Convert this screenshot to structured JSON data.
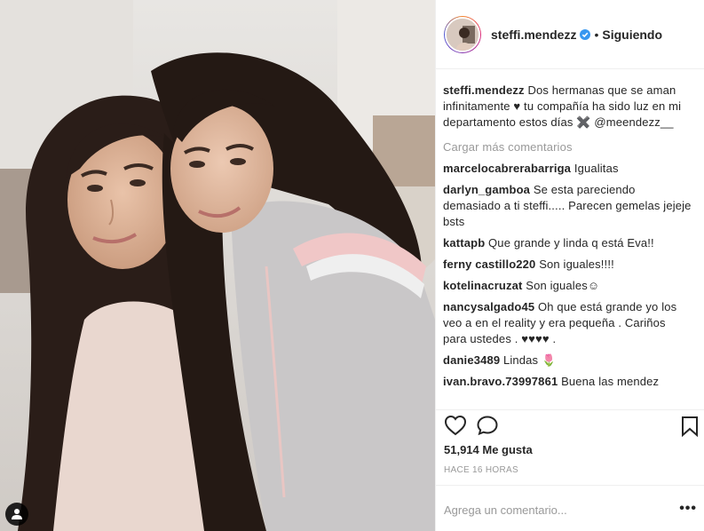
{
  "post": {
    "username": "steffi.mendezz",
    "follow_status": "Siguiendo",
    "separator": "•",
    "caption_text": "Dos hermanas que se aman infinitamente ♥ tu compañía ha sido luz en mi departamento estos días ✖️ @meendezz__",
    "load_more": "Cargar más comentarios",
    "comments": [
      {
        "user": "marcelocabrerabarriga",
        "text": "Igualitas"
      },
      {
        "user": "darlyn_gamboa",
        "text": "Se esta pareciendo demasiado a ti steffi..... Parecen gemelas jejeje bsts"
      },
      {
        "user": "kattapb",
        "text": "Que grande y linda q está Eva!!"
      },
      {
        "user": "ferny castillo220",
        "text": "Son iguales!!!!"
      },
      {
        "user": "kotelinacruzat",
        "text": "Son iguales☺"
      },
      {
        "user": "nancysalgado45",
        "text": "Oh que está grande yo los veo a en el reality y era pequeña . Cariños para ustedes . ♥♥♥♥ ."
      },
      {
        "user": "danie3489",
        "text": "Lindas 🌷"
      },
      {
        "user": "ivan.bravo.73997861",
        "text": "Buena las mendez"
      }
    ],
    "likes": "51,914 Me gusta",
    "timestamp": "HACE 16 HORAS",
    "add_comment_placeholder": "Agrega un comentario...",
    "more_options": "•••"
  },
  "colors": {
    "verified_blue": "#3897f0",
    "muted_text": "#999999",
    "primary_text": "#262626"
  },
  "icons": {
    "heart": "heart-icon",
    "comment": "comment-icon",
    "save": "bookmark-icon",
    "tag": "user-tag-icon",
    "verified": "verified-badge-icon"
  }
}
